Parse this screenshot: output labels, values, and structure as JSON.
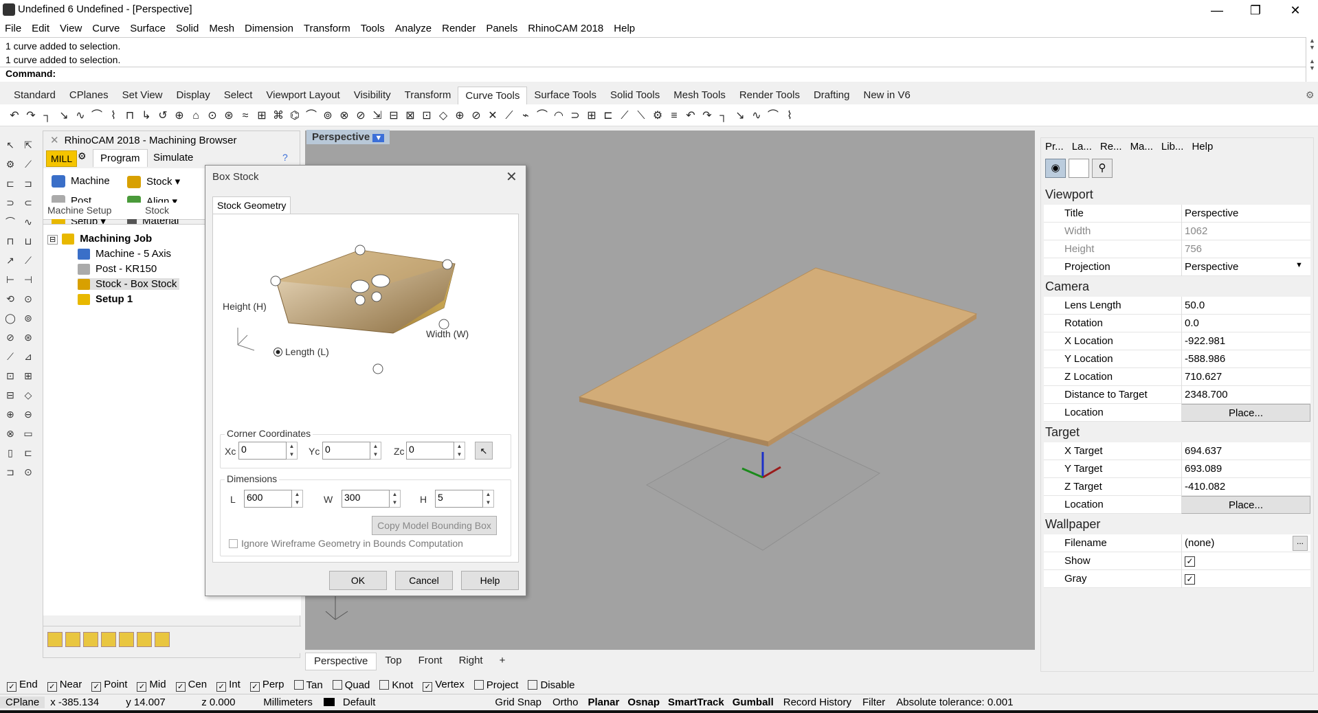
{
  "window": {
    "title": "Undefined 6 Undefined - [Perspective]",
    "min": "—",
    "max": "❐",
    "close": "✕"
  },
  "menu": [
    "File",
    "Edit",
    "View",
    "Curve",
    "Surface",
    "Solid",
    "Mesh",
    "Dimension",
    "Transform",
    "Tools",
    "Analyze",
    "Render",
    "Panels",
    "RhinoCAM 2018",
    "Help"
  ],
  "history": [
    "1 curve added to selection.",
    "1 curve added to selection."
  ],
  "command": {
    "label": "Command:",
    "value": ""
  },
  "toolbar_tabs": [
    "Standard",
    "CPlanes",
    "Set View",
    "Display",
    "Select",
    "Viewport Layout",
    "Visibility",
    "Transform",
    "Curve Tools",
    "Surface Tools",
    "Solid Tools",
    "Mesh Tools",
    "Render Tools",
    "Drafting",
    "New in V6"
  ],
  "active_toolbar_tab": "Curve Tools",
  "browser": {
    "title": "RhinoCAM 2018 - Machining Browser",
    "mode": "MILL",
    "tabs": [
      "Program",
      "Simulate"
    ],
    "machine": "Machine",
    "post": "Post",
    "setup": "Setup",
    "stock": "Stock",
    "align": "Align",
    "material": "Material",
    "group1": "Machine Setup",
    "group2": "Stock",
    "tree": {
      "root": "Machining Job",
      "items": [
        "Machine - 5 Axis",
        "Post - KR150",
        "Stock - Box Stock"
      ],
      "setup": "Setup 1"
    }
  },
  "viewport": {
    "label": "Perspective",
    "tabs": [
      "Perspective",
      "Top",
      "Front",
      "Right"
    ],
    "add": "+"
  },
  "dialog": {
    "title": "Box Stock",
    "tab": "Stock Geometry",
    "height_label": "Height (H)",
    "width_label": "Width (W)",
    "length_label": "Length (L)",
    "corner": {
      "legend": "Corner Coordinates",
      "xc_label": "Xc",
      "xc": "0",
      "yc_label": "Yc",
      "yc": "0",
      "zc_label": "Zc",
      "zc": "0"
    },
    "dims": {
      "legend": "Dimensions",
      "l_label": "L",
      "l": "600",
      "w_label": "W",
      "w": "300",
      "h_label": "H",
      "h": "5"
    },
    "copy_bbox": "Copy Model Bounding Box",
    "ignore_wire": "Ignore Wireframe Geometry in Bounds Computation",
    "ok": "OK",
    "cancel": "Cancel",
    "help": "Help"
  },
  "props": {
    "tabs": [
      "Pr...",
      "La...",
      "Re...",
      "Ma...",
      "Lib...",
      "Help"
    ],
    "viewport_section": "Viewport",
    "viewport": [
      {
        "k": "Title",
        "v": "Perspective"
      },
      {
        "k": "Width",
        "v": "1062"
      },
      {
        "k": "Height",
        "v": "756"
      },
      {
        "k": "Projection",
        "v": "Perspective"
      }
    ],
    "camera_section": "Camera",
    "camera": [
      {
        "k": "Lens Length",
        "v": "50.0"
      },
      {
        "k": "Rotation",
        "v": "0.0"
      },
      {
        "k": "X Location",
        "v": "-922.981"
      },
      {
        "k": "Y Location",
        "v": "-588.986"
      },
      {
        "k": "Z Location",
        "v": "710.627"
      },
      {
        "k": "Distance to Target",
        "v": "2348.700"
      },
      {
        "k": "Location",
        "v": "Place..."
      }
    ],
    "target_section": "Target",
    "target": [
      {
        "k": "X Target",
        "v": "694.637"
      },
      {
        "k": "Y Target",
        "v": "693.089"
      },
      {
        "k": "Z Target",
        "v": "-410.082"
      },
      {
        "k": "Location",
        "v": "Place..."
      }
    ],
    "wallpaper_section": "Wallpaper",
    "wallpaper": [
      {
        "k": "Filename",
        "v": "(none)"
      },
      {
        "k": "Show",
        "v": "✓"
      },
      {
        "k": "Gray",
        "v": "✓"
      }
    ]
  },
  "osnap": [
    {
      "l": "End",
      "c": true
    },
    {
      "l": "Near",
      "c": true
    },
    {
      "l": "Point",
      "c": true
    },
    {
      "l": "Mid",
      "c": true
    },
    {
      "l": "Cen",
      "c": true
    },
    {
      "l": "Int",
      "c": true
    },
    {
      "l": "Perp",
      "c": true
    },
    {
      "l": "Tan",
      "c": false
    },
    {
      "l": "Quad",
      "c": false
    },
    {
      "l": "Knot",
      "c": false
    },
    {
      "l": "Vertex",
      "c": true
    },
    {
      "l": "Project",
      "c": false
    },
    {
      "l": "Disable",
      "c": false
    }
  ],
  "status": {
    "cplane": "CPlane",
    "x": "x -385.134",
    "y": "y 14.007",
    "z": "z 0.000",
    "units": "Millimeters",
    "layer": "Default",
    "grid": "Grid Snap",
    "ortho": "Ortho",
    "planar": "Planar",
    "osnap": "Osnap",
    "smarttrack": "SmartTrack",
    "gumball": "Gumball",
    "record": "Record History",
    "filter": "Filter",
    "tolerance": "Absolute tolerance: 0.001"
  }
}
